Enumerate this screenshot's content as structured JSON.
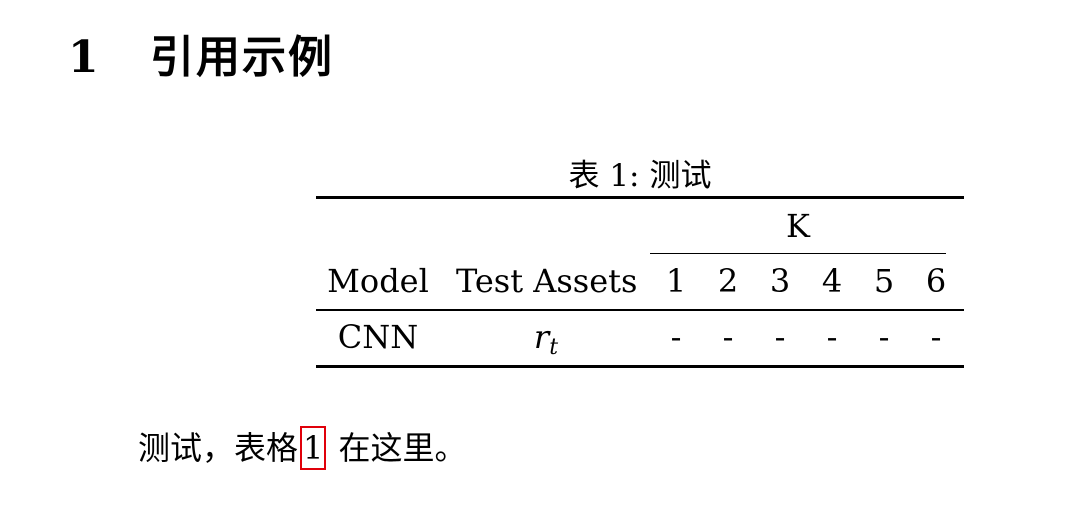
{
  "section": {
    "number": "1",
    "title": "引用示例"
  },
  "table": {
    "caption_label": "表 1:",
    "caption_text": "测试",
    "group_header": "K",
    "headers": {
      "model": "Model",
      "assets": "Test Assets",
      "k": [
        "1",
        "2",
        "3",
        "4",
        "5",
        "6"
      ]
    },
    "rows": [
      {
        "model": "CNN",
        "assets_var": "r",
        "assets_sub": "t",
        "values": [
          "-",
          "-",
          "-",
          "-",
          "-",
          "-"
        ]
      }
    ]
  },
  "paragraph": {
    "before": "测试，表格",
    "ref": "1",
    "after": " 在这里。"
  },
  "colors": {
    "ref_box": "#e0000a"
  }
}
